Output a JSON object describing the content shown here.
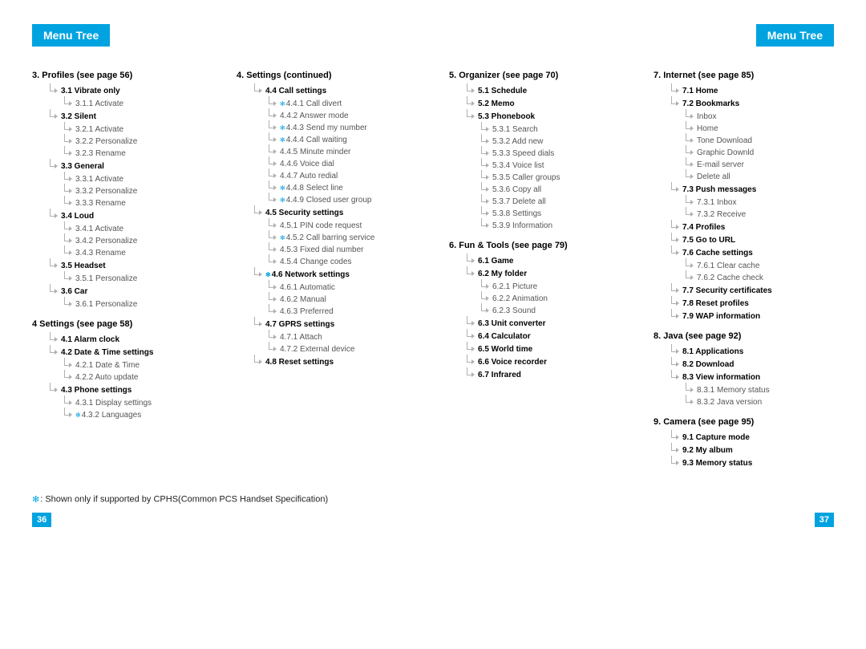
{
  "header": {
    "title": "Menu Tree"
  },
  "footnote": "Shown only if supported by CPHS(Common PCS Handset Specification)",
  "page_numbers": {
    "left": "36",
    "right": "37"
  },
  "columns": [
    [
      {
        "type": "section",
        "label": "3.  Profiles (see page 56)"
      },
      {
        "type": "l2",
        "label": "3.1 Vibrate only"
      },
      {
        "type": "l3",
        "label": "3.1.1 Activate"
      },
      {
        "type": "l2",
        "label": "3.2 Silent"
      },
      {
        "type": "l3",
        "label": "3.2.1 Activate"
      },
      {
        "type": "l3",
        "label": "3.2.2 Personalize"
      },
      {
        "type": "l3",
        "label": "3.2.3 Rename"
      },
      {
        "type": "l2",
        "label": "3.3 General"
      },
      {
        "type": "l3",
        "label": "3.3.1 Activate"
      },
      {
        "type": "l3",
        "label": "3.3.2 Personalize"
      },
      {
        "type": "l3",
        "label": "3.3.3 Rename"
      },
      {
        "type": "l2",
        "label": "3.4 Loud"
      },
      {
        "type": "l3",
        "label": "3.4.1 Activate"
      },
      {
        "type": "l3",
        "label": "3.4.2 Personalize"
      },
      {
        "type": "l3",
        "label": "3.4.3 Rename"
      },
      {
        "type": "l2",
        "label": "3.5 Headset"
      },
      {
        "type": "l3",
        "label": "3.5.1 Personalize"
      },
      {
        "type": "l2",
        "label": "3.6 Car"
      },
      {
        "type": "l3",
        "label": "3.6.1 Personalize"
      },
      {
        "type": "section",
        "label": "4   Settings (see page 58)"
      },
      {
        "type": "l2",
        "label": "4.1 Alarm clock"
      },
      {
        "type": "l2",
        "label": "4.2 Date & Time settings"
      },
      {
        "type": "l3",
        "label": "4.2.1 Date & Time"
      },
      {
        "type": "l3",
        "label": "4.2.2 Auto update"
      },
      {
        "type": "l2",
        "label": "4.3 Phone settings"
      },
      {
        "type": "l3",
        "label": "4.3.1 Display settings"
      },
      {
        "type": "l3",
        "label": "4.3.2 Languages",
        "star": true
      }
    ],
    [
      {
        "type": "section",
        "label": "4.  Settings (continued)"
      },
      {
        "type": "l2",
        "label": "4.4 Call settings"
      },
      {
        "type": "l3",
        "label": "4.4.1 Call divert",
        "star": true
      },
      {
        "type": "l3",
        "label": "4.4.2 Answer mode"
      },
      {
        "type": "l3",
        "label": "4.4.3 Send my number",
        "star": true
      },
      {
        "type": "l3",
        "label": "4.4.4 Call waiting",
        "star": true
      },
      {
        "type": "l3",
        "label": "4.4.5 Minute minder"
      },
      {
        "type": "l3",
        "label": "4.4.6 Voice dial"
      },
      {
        "type": "l3",
        "label": "4.4.7 Auto redial"
      },
      {
        "type": "l3",
        "label": "4.4.8 Select line",
        "star": true
      },
      {
        "type": "l3",
        "label": "4.4.9 Closed user group",
        "star": true
      },
      {
        "type": "l2",
        "label": "4.5 Security settings"
      },
      {
        "type": "l3",
        "label": "4.5.1 PIN code request"
      },
      {
        "type": "l3",
        "label": "4.5.2 Call barring service",
        "star": true
      },
      {
        "type": "l3",
        "label": "4.5.3 Fixed dial number"
      },
      {
        "type": "l3",
        "label": "4.5.4 Change codes"
      },
      {
        "type": "l2",
        "label": "4.6 Network settings",
        "star": true
      },
      {
        "type": "l3",
        "label": "4.6.1 Automatic"
      },
      {
        "type": "l3",
        "label": "4.6.2 Manual"
      },
      {
        "type": "l3",
        "label": "4.6.3 Preferred"
      },
      {
        "type": "l2",
        "label": "4.7 GPRS settings"
      },
      {
        "type": "l3",
        "label": "4.7.1 Attach"
      },
      {
        "type": "l3",
        "label": "4.7.2 External device"
      },
      {
        "type": "l2",
        "label": "4.8 Reset settings"
      }
    ],
    [
      {
        "type": "section",
        "label": "5. Organizer (see page 70)"
      },
      {
        "type": "l2",
        "label": "5.1 Schedule"
      },
      {
        "type": "l2",
        "label": "5.2 Memo"
      },
      {
        "type": "l2",
        "label": "5.3 Phonebook"
      },
      {
        "type": "l3",
        "label": "5.3.1 Search"
      },
      {
        "type": "l3",
        "label": "5.3.2 Add new"
      },
      {
        "type": "l3",
        "label": "5.3.3 Speed dials"
      },
      {
        "type": "l3",
        "label": "5.3.4 Voice list"
      },
      {
        "type": "l3",
        "label": "5.3.5 Caller groups"
      },
      {
        "type": "l3",
        "label": "5.3.6 Copy all"
      },
      {
        "type": "l3",
        "label": "5.3.7 Delete all"
      },
      {
        "type": "l3",
        "label": "5.3.8 Settings"
      },
      {
        "type": "l3",
        "label": "5.3.9 Information"
      },
      {
        "type": "section",
        "label": "6. Fun & Tools (see page 79)"
      },
      {
        "type": "l2",
        "label": "6.1 Game"
      },
      {
        "type": "l2",
        "label": "6.2 My folder"
      },
      {
        "type": "l3",
        "label": "6.2.1 Picture"
      },
      {
        "type": "l3",
        "label": "6.2.2 Animation"
      },
      {
        "type": "l3",
        "label": "6.2.3 Sound"
      },
      {
        "type": "l2",
        "label": "6.3 Unit converter"
      },
      {
        "type": "l2",
        "label": "6.4 Calculator"
      },
      {
        "type": "l2",
        "label": "6.5 World time"
      },
      {
        "type": "l2",
        "label": "6.6 Voice recorder"
      },
      {
        "type": "l2",
        "label": "6.7 Infrared"
      }
    ],
    [
      {
        "type": "section",
        "label": "7. Internet (see page 85)"
      },
      {
        "type": "l2",
        "label": "7.1 Home"
      },
      {
        "type": "l2",
        "label": "7.2 Bookmarks"
      },
      {
        "type": "l3",
        "label": "Inbox"
      },
      {
        "type": "l3",
        "label": "Home"
      },
      {
        "type": "l3",
        "label": "Tone Download"
      },
      {
        "type": "l3",
        "label": "Graphic Downld"
      },
      {
        "type": "l3",
        "label": "E-mail server"
      },
      {
        "type": "l3",
        "label": "Delete all"
      },
      {
        "type": "l2",
        "label": "7.3 Push messages"
      },
      {
        "type": "l3",
        "label": "7.3.1 Inbox"
      },
      {
        "type": "l3",
        "label": "7.3.2 Receive"
      },
      {
        "type": "l2",
        "label": "7.4 Profiles"
      },
      {
        "type": "l2",
        "label": "7.5 Go to URL"
      },
      {
        "type": "l2",
        "label": "7.6 Cache settings"
      },
      {
        "type": "l3",
        "label": "7.6.1 Clear cache"
      },
      {
        "type": "l3",
        "label": "7.6.2 Cache check"
      },
      {
        "type": "l2",
        "label": "7.7 Security certificates"
      },
      {
        "type": "l2",
        "label": "7.8 Reset profiles"
      },
      {
        "type": "l2",
        "label": "7.9 WAP information"
      },
      {
        "type": "section",
        "label": "8. Java (see page 92)"
      },
      {
        "type": "l2",
        "label": "8.1 Applications"
      },
      {
        "type": "l2",
        "label": "8.2 Download"
      },
      {
        "type": "l2",
        "label": "8.3 View information"
      },
      {
        "type": "l3",
        "label": "8.3.1 Memory status"
      },
      {
        "type": "l3",
        "label": "8.3.2 Java version"
      },
      {
        "type": "section",
        "label": "9. Camera (see page 95)"
      },
      {
        "type": "l2",
        "label": "9.1 Capture mode"
      },
      {
        "type": "l2",
        "label": "9.2 My album"
      },
      {
        "type": "l2",
        "label": "9.3 Memory status"
      }
    ]
  ]
}
